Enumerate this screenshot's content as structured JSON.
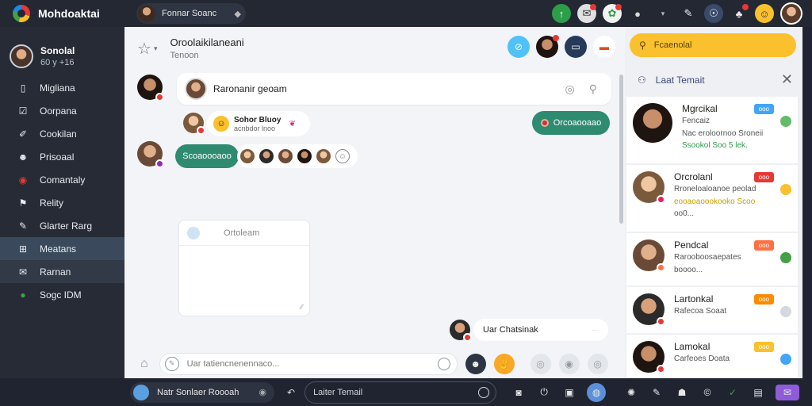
{
  "app": {
    "title": "Mohdoaktai",
    "search_label": "Fonnar Soanc"
  },
  "sidebar": {
    "profile": {
      "name": "Sonolal",
      "sub": "60 y +16"
    },
    "items": [
      {
        "label": "Migliana",
        "icon": "document-icon"
      },
      {
        "label": "Oorpana",
        "icon": "checkbox-icon"
      },
      {
        "label": "Cookilan",
        "icon": "brush-icon"
      },
      {
        "label": "Prisoaal",
        "icon": "face-icon"
      },
      {
        "label": "Comantaly",
        "icon": "alert-circle-icon"
      },
      {
        "label": "Relity",
        "icon": "flag-icon"
      },
      {
        "label": "Glarter Rarg",
        "icon": "pencil-icon"
      },
      {
        "label": "Meatans",
        "icon": "grid-icon"
      },
      {
        "label": "Rarnan",
        "icon": "mail-icon"
      },
      {
        "label": "Sogc IDM",
        "icon": "globe-icon"
      }
    ]
  },
  "chat": {
    "title": "Oroolaikilaneani",
    "subtitle": "Tenoon",
    "message1": "Raronanir geoam",
    "reaction_title": "Sohor Bluoy",
    "reaction_sub": "acnbdor lnoo",
    "reply_button": "Orcoaooaao",
    "pill_label": "Scoaoooaoo",
    "note_title": "Ortoleam",
    "outgoing_message": "Uar Chatsinak",
    "composer_placeholder": "Uar tatiencnenennaco..."
  },
  "rpanel": {
    "search_placeholder": "Fcaenolal",
    "header": "Laat Temait",
    "contacts": [
      {
        "name": "Mgrcikal",
        "tag": "ooo",
        "line1": "Fencaiz",
        "line2": "Nac eroloornoo Sroneii",
        "line3": "Ssookol Soo 5 lek."
      },
      {
        "name": "Orcrolanl",
        "tag": "ooo",
        "line1": "Rroneloaloanoe peolad",
        "line2": "eooaoaoookooko Scoo",
        "line3": "oo0..."
      },
      {
        "name": "Pendcal",
        "tag": "ooo",
        "line1": "Rarooboosaepates",
        "line2": "boooo...",
        "line3": ""
      },
      {
        "name": "Lartonkal",
        "tag": "ooo",
        "line1": "Rafecoa Soaat",
        "line2": "",
        "line3": ""
      },
      {
        "name": "Lamokal",
        "tag": "ooo",
        "line1": "Carfeoes Doata",
        "line2": "",
        "line3": ""
      }
    ]
  },
  "taskbar": {
    "user_label": "Natr Sonlaer Roooah",
    "input_placeholder": "Laiter Temail"
  }
}
